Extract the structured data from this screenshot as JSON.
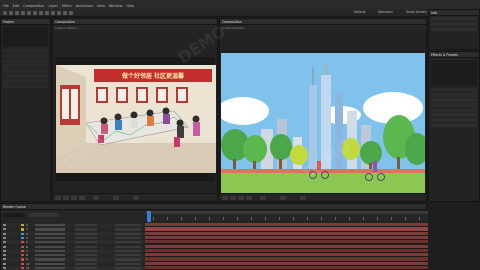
{
  "menu": [
    "File",
    "Edit",
    "Composition",
    "Layer",
    "Effect",
    "Animation",
    "View",
    "Window",
    "Help"
  ],
  "workspace_tabs": [
    "Default",
    "Standard",
    "Small Screen"
  ],
  "project_panel": {
    "label": "Project"
  },
  "left_viewer": {
    "tab": "Composition",
    "sub_label": "Active Camera",
    "view_label": "Custom View 1",
    "banner": "做个好邻居 社区更温馨"
  },
  "right_viewer": {
    "tab": "Composition",
    "sub_label": "Active Camera"
  },
  "side_panel": {
    "label": "Info"
  },
  "effects_panel": {
    "label": "Effects & Presets"
  },
  "timeline": {
    "tab": "Render Queue",
    "layers": [
      {
        "num": "1",
        "color": "#c7a82d",
        "bar": "#7a3b3b"
      },
      {
        "num": "2",
        "color": "#c7a82d",
        "bar": "#8a4a4a"
      },
      {
        "num": "3",
        "color": "#4f8fc9",
        "bar": "#7a3b3b"
      },
      {
        "num": "4",
        "color": "#4f8fc9",
        "bar": "#7a3b3b"
      },
      {
        "num": "5",
        "color": "#c94f4f",
        "bar": "#6e2f2f"
      },
      {
        "num": "6",
        "color": "#c94f4f",
        "bar": "#7a3b3b"
      },
      {
        "num": "7",
        "color": "#c94f4f",
        "bar": "#6e2f2f"
      },
      {
        "num": "8",
        "color": "#c94f4f",
        "bar": "#7a3b3b"
      },
      {
        "num": "9",
        "color": "#c94f4f",
        "bar": "#6e2f2f"
      },
      {
        "num": "10",
        "color": "#c94f4f",
        "bar": "#7a3b3b"
      },
      {
        "num": "11",
        "color": "#c94f4f",
        "bar": "#6e2f2f"
      }
    ]
  },
  "watermark": "DEMO",
  "colors": {
    "accent": "#3a7bd5",
    "sky": "#7fc2ec",
    "wall": "#e9e0cf"
  }
}
